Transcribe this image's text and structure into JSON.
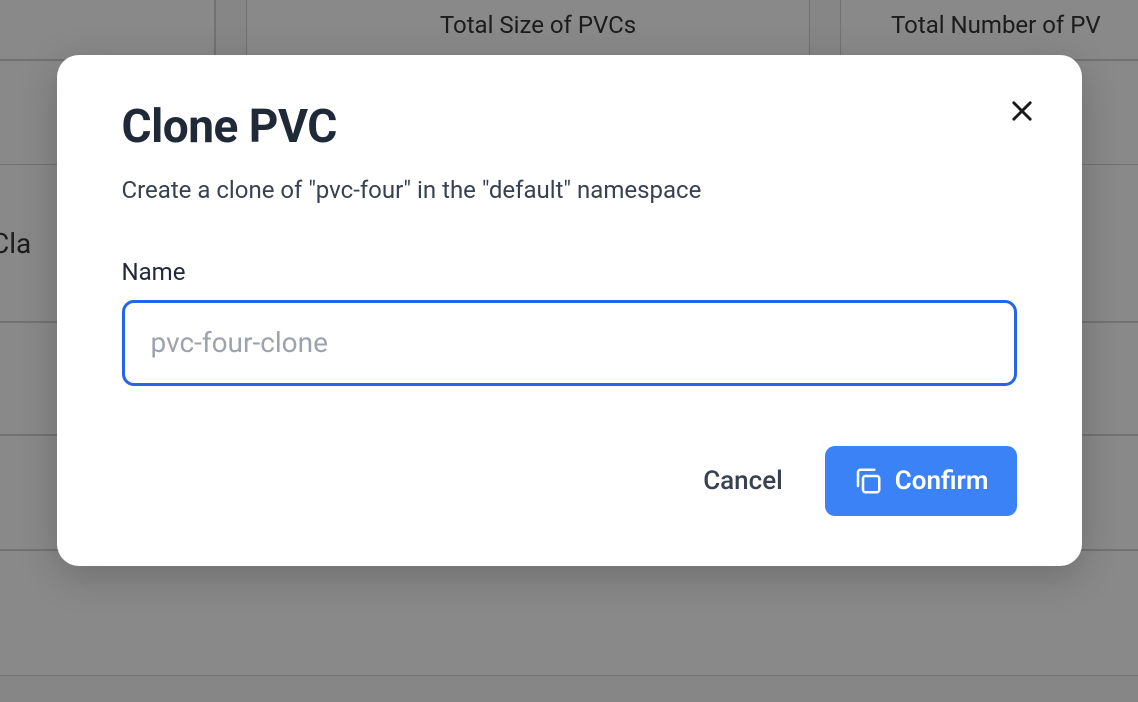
{
  "background": {
    "headers": {
      "col1": "Total Size of PVCs",
      "col2": "Total Number of PV"
    },
    "row_label": "Cla"
  },
  "modal": {
    "title": "Clone PVC",
    "subtitle": "Create a clone of \"pvc-four\" in the \"default\" namespace",
    "form": {
      "name_label": "Name",
      "name_placeholder": "pvc-four-clone",
      "name_value": ""
    },
    "buttons": {
      "cancel": "Cancel",
      "confirm": "Confirm"
    }
  }
}
